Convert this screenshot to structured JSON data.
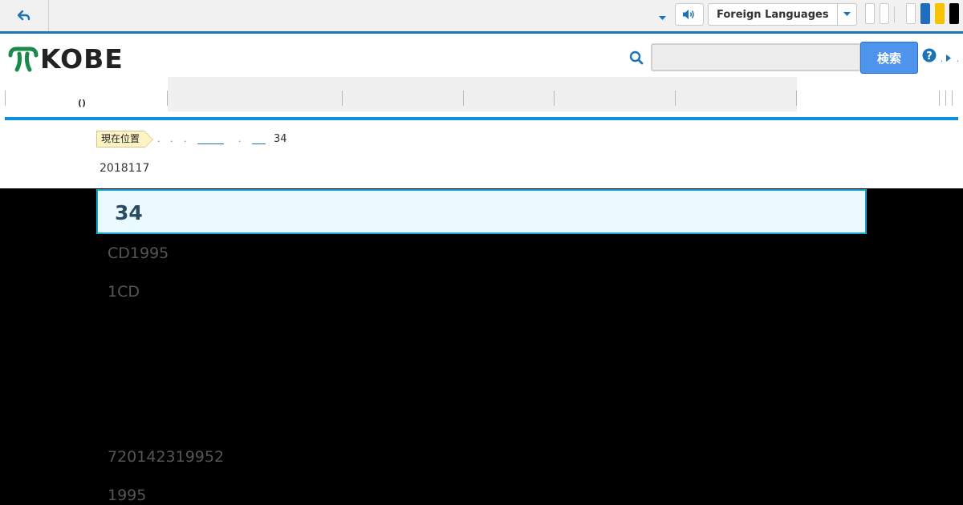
{
  "topbar": {
    "language_select": "Foreign Languages"
  },
  "header": {
    "logo_text": "KOBE",
    "search_button": "検索",
    "search_placeholder": ""
  },
  "nav": {
    "first_item": "()"
  },
  "breadcrumb": {
    "label": "現在位置",
    "current": "34"
  },
  "article": {
    "date": "2018117",
    "title": "34",
    "lines": [
      "CD1995",
      "1CD",
      "720142319952",
      "1995"
    ]
  },
  "colors": {
    "accent": "#1b73b8",
    "nav_line": "#0a93d6",
    "search_button": "#4f94ec",
    "title_border": "#13a7d6",
    "title_bg": "#eafaff",
    "logo_green": "#1a8a4a"
  }
}
